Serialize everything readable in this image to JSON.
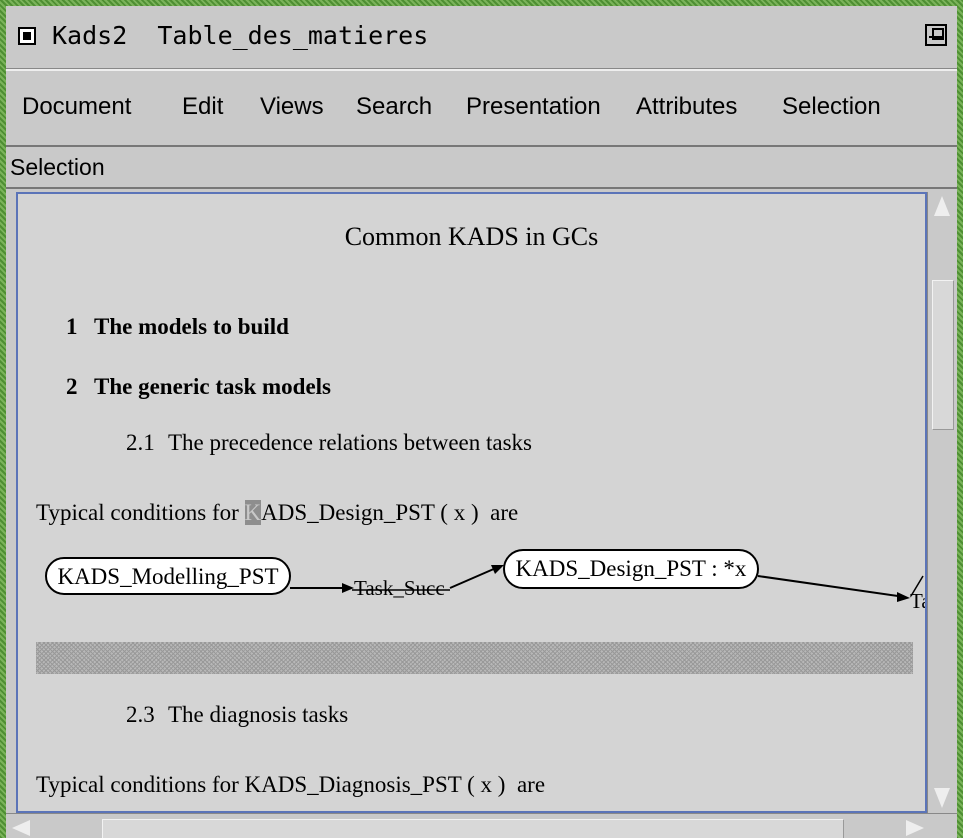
{
  "window": {
    "title": "Kads2  Table_des_matieres"
  },
  "menubar": {
    "items": [
      "Document",
      "Edit",
      "Views",
      "Search",
      "Presentation",
      "Attributes",
      "Selection"
    ]
  },
  "selection_bar": {
    "label": "Selection"
  },
  "document": {
    "title": "Common KADS in GCs",
    "sections": [
      {
        "number": "1",
        "title": "The models to build"
      },
      {
        "number": "2",
        "title": "The generic task models"
      }
    ],
    "subsection_2_1": {
      "number": "2.1",
      "title": "The precedence relations between tasks"
    },
    "conditions_1": {
      "prefix": "Typical conditions for ",
      "highlight": "K",
      "rest": "ADS_Design_PST ( x )  are"
    },
    "graph": {
      "node_1": "KADS_Modelling_PST",
      "edge_1": "Task_Succ",
      "node_2": "KADS_Design_PST : *x",
      "edge_2_partial": "Ta"
    },
    "subsection_2_3": {
      "number": "2.3",
      "title": "The diagnosis tasks"
    },
    "conditions_2": "Typical conditions for KADS_Diagnosis_PST ( x )  are"
  }
}
